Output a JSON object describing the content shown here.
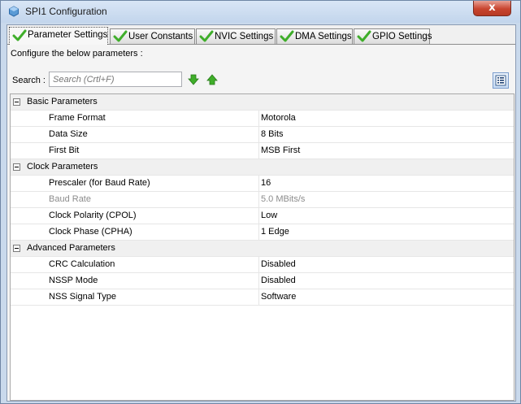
{
  "window": {
    "title": "SPI1 Configuration",
    "close_label": "x"
  },
  "tabs": [
    {
      "label": "Parameter Settings"
    },
    {
      "label": "User Constants"
    },
    {
      "label": "NVIC Settings"
    },
    {
      "label": "DMA Settings"
    },
    {
      "label": "GPIO Settings"
    }
  ],
  "pane": {
    "instruction": "Configure the below parameters :",
    "search_label": "Search :",
    "search_placeholder": "Search (Crtl+F)"
  },
  "groups": [
    {
      "label": "Basic Parameters",
      "params": [
        {
          "name": "Frame Format",
          "value": "Motorola"
        },
        {
          "name": "Data Size",
          "value": "8 Bits"
        },
        {
          "name": "First Bit",
          "value": "MSB First"
        }
      ]
    },
    {
      "label": "Clock Parameters",
      "params": [
        {
          "name": "Prescaler (for Baud Rate)",
          "value": "16"
        },
        {
          "name": "Baud Rate",
          "value": "5.0 MBits/s"
        },
        {
          "name": "Clock Polarity (CPOL)",
          "value": "Low"
        },
        {
          "name": "Clock Phase (CPHA)",
          "value": "1 Edge"
        }
      ]
    },
    {
      "label": "Advanced Parameters",
      "params": [
        {
          "name": "CRC Calculation",
          "value": "Disabled"
        },
        {
          "name": "NSSP Mode",
          "value": "Disabled"
        },
        {
          "name": "NSS Signal Type",
          "value": "Software"
        }
      ]
    }
  ],
  "colors": {
    "check_green": "#3fae2a",
    "title_bg": "#c9d9ec",
    "close_red": "#c8452f"
  }
}
